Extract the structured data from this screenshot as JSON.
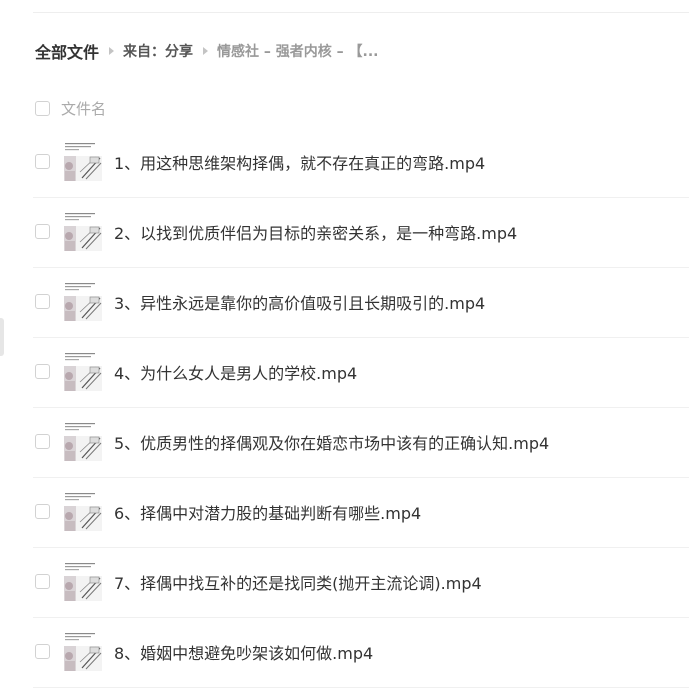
{
  "breadcrumb": {
    "root": "全部文件",
    "from": "来自：分享",
    "current": "情感社 – 强者内核 – 【..."
  },
  "list_header": {
    "name_column": "文件名"
  },
  "files": [
    {
      "name": "1、用这种思维架构择偶，就不存在真正的弯路.mp4",
      "type_icon": "video-thumbnail"
    },
    {
      "name": "2、以找到优质伴侣为目标的亲密关系，是一种弯路.mp4",
      "type_icon": "video-thumbnail"
    },
    {
      "name": "3、异性永远是靠你的高价值吸引且长期吸引的.mp4",
      "type_icon": "video-thumbnail"
    },
    {
      "name": "4、为什么女人是男人的学校.mp4",
      "type_icon": "video-thumbnail"
    },
    {
      "name": "5、优质男性的择偶观及你在婚恋市场中该有的正确认知.mp4",
      "type_icon": "video-thumbnail"
    },
    {
      "name": "6、择偶中对潜力股的基础判断有哪些.mp4",
      "type_icon": "video-thumbnail"
    },
    {
      "name": "7、择偶中找互补的还是找同类(抛开主流论调).mp4",
      "type_icon": "video-thumbnail"
    },
    {
      "name": "8、婚姻中想避免吵架该如何做.mp4",
      "type_icon": "video-thumbnail"
    }
  ],
  "colors": {
    "text_primary": "#333333",
    "text_secondary": "#999999",
    "divider": "#f0f0f0",
    "checkbox_border": "#d2d2d2"
  }
}
